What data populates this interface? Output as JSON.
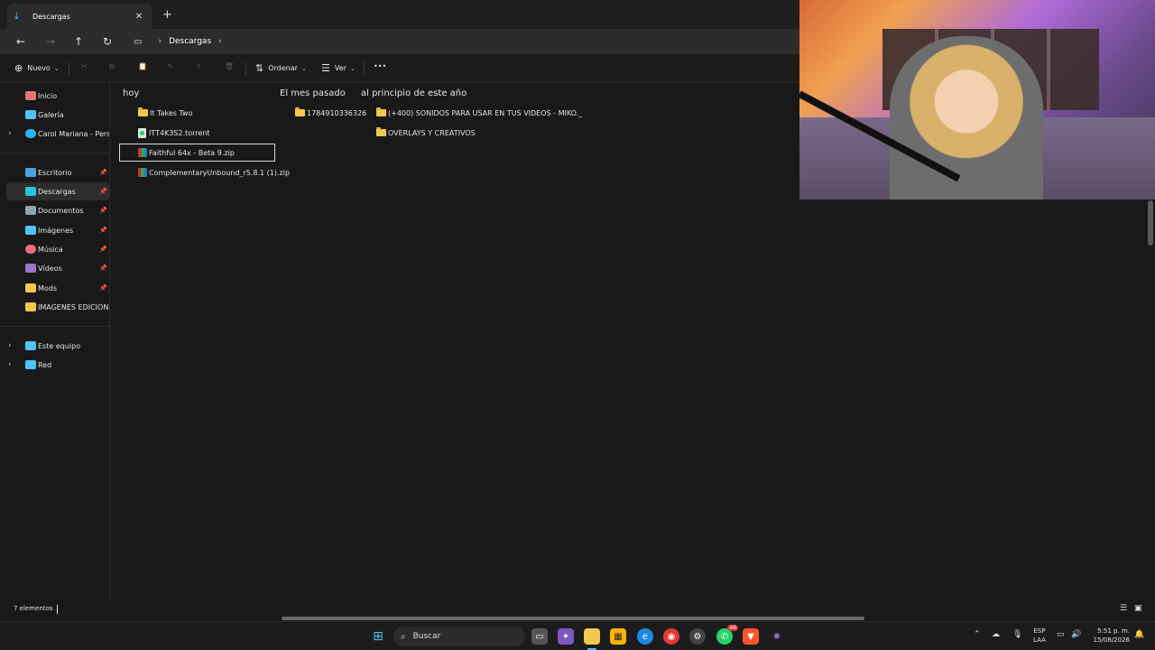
{
  "window": {
    "tab_title": "Descargas",
    "tab_close": "✕",
    "new_tab": "+"
  },
  "nav": {
    "back": "←",
    "forward": "→",
    "up": "↑",
    "refresh": "↻",
    "breadcrumb": [
      "Descargas"
    ]
  },
  "toolbar": {
    "new_label": "Nuevo",
    "sort_label": "Ordenar",
    "view_label": "Ver",
    "more_label": "•••"
  },
  "sidebar": {
    "items": [
      {
        "label": "Inicio",
        "icon": "home-icon",
        "color": "#e57373"
      },
      {
        "label": "Galería",
        "icon": "gallery-icon",
        "color": "#4fc3f7"
      },
      {
        "label": "Carol Mariana - Personal",
        "icon": "cloud-icon",
        "color": "#29b6f6"
      },
      {
        "label": "Escritorio",
        "icon": "desktop-icon",
        "color": "#4aa3df"
      },
      {
        "label": "Descargas",
        "icon": "download-icon",
        "color": "#26c6da"
      },
      {
        "label": "Documentos",
        "icon": "document-icon",
        "color": "#90a4ae"
      },
      {
        "label": "Imágenes",
        "icon": "image-icon",
        "color": "#4fc3f7"
      },
      {
        "label": "Música",
        "icon": "music-icon",
        "color": "#ef6c7d"
      },
      {
        "label": "Vídeos",
        "icon": "video-icon",
        "color": "#9575cd"
      },
      {
        "label": "Mods",
        "icon": "folder-icon",
        "color": "#f2c94c"
      },
      {
        "label": "IMAGENES EDICION",
        "icon": "folder-icon",
        "color": "#f2c94c"
      },
      {
        "label": "Este equipo",
        "icon": "computer-icon",
        "color": "#4fc3f7"
      },
      {
        "label": "Red",
        "icon": "network-icon",
        "color": "#4fc3f7"
      }
    ]
  },
  "content": {
    "groups": [
      {
        "heading": "hoy",
        "items": [
          "It Takes Two",
          "ITT4K3S2.torrent",
          "Faithful 64x - Beta 9.zip",
          "ComplementaryUnbound_r5.8.1 (1).zip"
        ]
      },
      {
        "heading": "El mes pasado",
        "items": [
          "1784910336326"
        ]
      },
      {
        "heading": "al principio de este año",
        "items": [
          "(+400) SONIDOS PARA USAR EN TUS VIDEOS - MIKO._",
          "OVERLAYS Y CREATIVOS"
        ]
      }
    ]
  },
  "status": {
    "count": "7 elementos"
  },
  "taskbar": {
    "search_placeholder": "Buscar",
    "whatsapp_badge": "46",
    "lang_line1": "ESP",
    "lang_line2": "LAA",
    "time": "5:51 p. m.",
    "date": "15/08/2026"
  }
}
